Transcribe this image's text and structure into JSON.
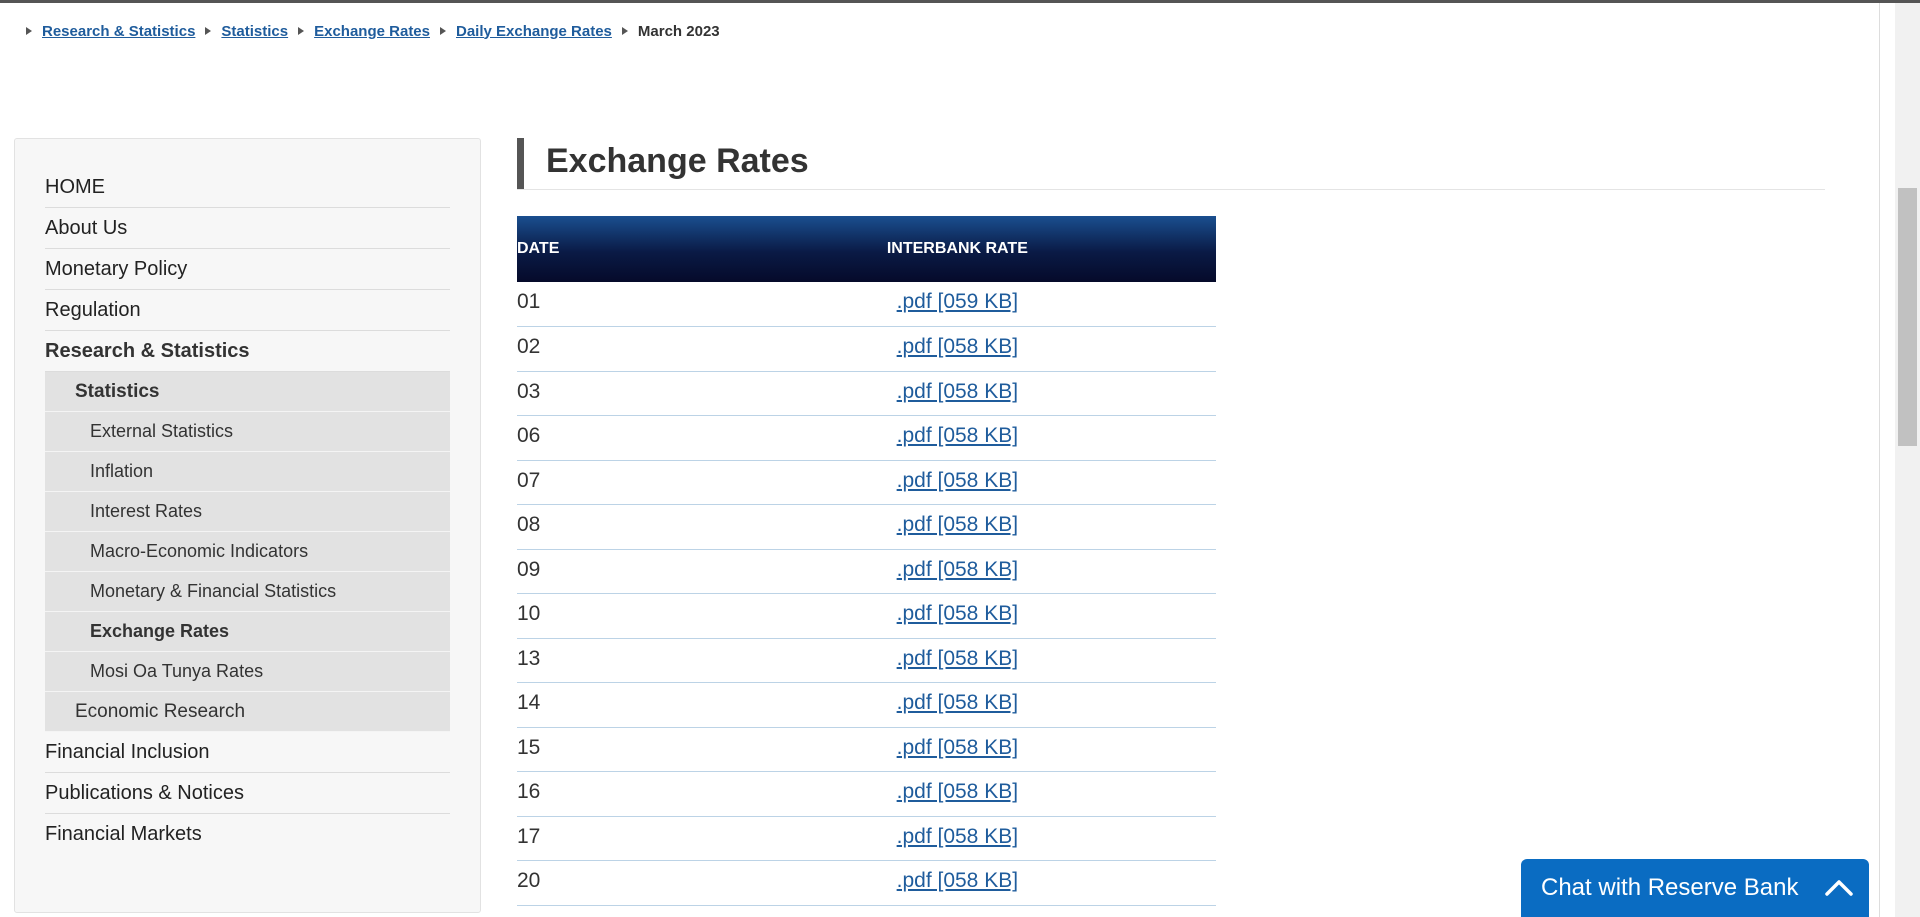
{
  "breadcrumb": {
    "items": [
      "Research & Statistics",
      "Statistics",
      "Exchange Rates",
      "Daily Exchange Rates"
    ],
    "current": "March 2023"
  },
  "sidebar": {
    "items": [
      {
        "label": "HOME"
      },
      {
        "label": "About Us"
      },
      {
        "label": "Monetary Policy"
      },
      {
        "label": "Regulation"
      },
      {
        "label": "Research & Statistics"
      }
    ],
    "statistics": {
      "label": "Statistics",
      "children": [
        "External Statistics",
        "Inflation",
        "Interest Rates",
        "Macro-Economic Indicators",
        "Monetary & Financial Statistics",
        "Exchange Rates",
        "Mosi Oa Tunya Rates"
      ]
    },
    "economic_research": "Economic Research",
    "bottom_items": [
      "Financial Inclusion",
      "Publications & Notices",
      "Financial Markets"
    ]
  },
  "main": {
    "title": "Exchange Rates",
    "table": {
      "headers": [
        "DATE",
        "INTERBANK RATE"
      ],
      "rows": [
        {
          "date": "01",
          "link": ".pdf [059 KB]"
        },
        {
          "date": "02",
          "link": ".pdf [058 KB]"
        },
        {
          "date": "03",
          "link": ".pdf [058 KB]"
        },
        {
          "date": "06",
          "link": ".pdf [058 KB]"
        },
        {
          "date": "07",
          "link": ".pdf [058 KB]"
        },
        {
          "date": "08",
          "link": ".pdf [058 KB]"
        },
        {
          "date": "09",
          "link": ".pdf [058 KB]"
        },
        {
          "date": "10",
          "link": ".pdf [058 KB]"
        },
        {
          "date": "13",
          "link": ".pdf [058 KB]"
        },
        {
          "date": "14",
          "link": ".pdf [058 KB]"
        },
        {
          "date": "15",
          "link": ".pdf [058 KB]"
        },
        {
          "date": "16",
          "link": ".pdf [058 KB]"
        },
        {
          "date": "17",
          "link": ".pdf [058 KB]"
        },
        {
          "date": "20",
          "link": ".pdf [058 KB]"
        }
      ]
    }
  },
  "chat": {
    "label": "Chat with Reserve Bank",
    "icon": "chevron-up-icon"
  },
  "colors": {
    "link": "#1f5c9c",
    "header_dark": "#050a2a",
    "chat_bg": "#0a6cc2"
  }
}
